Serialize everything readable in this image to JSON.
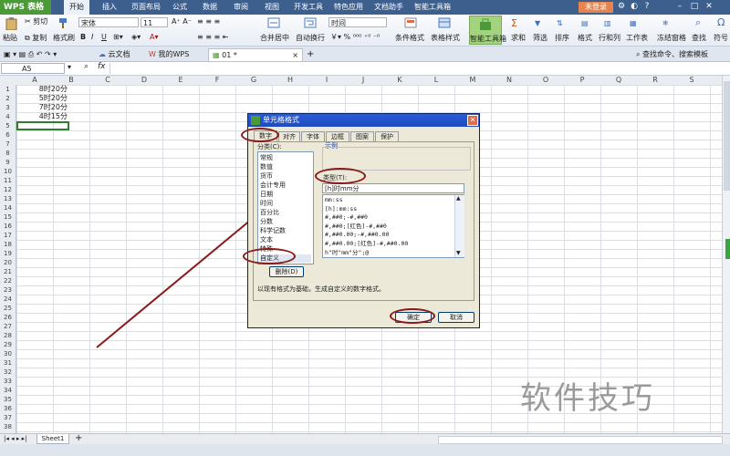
{
  "app": {
    "logo": "WPS 表格"
  },
  "menu": [
    "开始",
    "插入",
    "页面布局",
    "公式",
    "数据",
    "审阅",
    "视图",
    "开发工具",
    "特色应用",
    "文档助手",
    "智能工具箱"
  ],
  "login_label": "未登录",
  "ribbon": {
    "cut": "剪切",
    "paste": "粘贴",
    "copy": "复制",
    "format_painter": "格式刷",
    "font_name": "宋体",
    "font_size": "11",
    "merge_center": "合并居中",
    "wrap": "自动换行",
    "number_format": "时间",
    "cond_format": "条件格式",
    "table_style": "表格样式",
    "smart_toolbox": "智能工具箱",
    "sum": "求和",
    "filter": "筛选",
    "sort": "排序",
    "format": "格式",
    "row_col": "行和列",
    "worksheet": "工作表",
    "freeze": "冻结窗格",
    "find": "查找",
    "symbol": "符号"
  },
  "doc_tabs": [
    "云文档",
    "我的WPS"
  ],
  "current_tab": "01 *",
  "search_hint": "查找命令、搜索模板",
  "name_box": "A5",
  "columns": [
    "A",
    "B",
    "C",
    "D",
    "E",
    "F",
    "G",
    "H",
    "I",
    "J",
    "K",
    "L",
    "M",
    "N",
    "O",
    "P",
    "Q",
    "R",
    "S"
  ],
  "rows": [
    "1",
    "2",
    "3",
    "4",
    "5",
    "6",
    "7",
    "8",
    "9",
    "10",
    "11",
    "12",
    "13",
    "14",
    "15",
    "16",
    "17",
    "18",
    "19",
    "20",
    "21",
    "22",
    "23",
    "24",
    "25",
    "26",
    "27",
    "28",
    "29",
    "30",
    "31",
    "32",
    "33",
    "34",
    "35",
    "36",
    "37",
    "38"
  ],
  "cells": [
    "8时20分",
    "5时20分",
    "7时20分",
    "4时15分"
  ],
  "sheet_tab": "Sheet1",
  "dialog": {
    "title": "单元格格式",
    "tabs": [
      "数字",
      "对齐",
      "字体",
      "边框",
      "图案",
      "保护"
    ],
    "category_label": "分类(C):",
    "categories": [
      "常规",
      "数值",
      "货币",
      "会计专用",
      "日期",
      "时间",
      "百分比",
      "分数",
      "科学记数",
      "文本",
      "特殊",
      "自定义"
    ],
    "sample_label": "示例",
    "type_label": "类型(T):",
    "type_value": "[h]时mm分",
    "type_list": [
      "mm:ss",
      "[h]:mm:ss",
      "#,##0;-#,##0",
      "#,##0;[红色]-#,##0",
      "#,##0.00;-#,##0.00",
      "#,##0.00;[红色]-#,##0.00",
      "h\"时\"mm\"分\";@"
    ],
    "delete_button": "删除(D)",
    "description": "以现有格式为基础，生成自定义的数字格式。",
    "ok": "确定",
    "cancel": "取消"
  },
  "watermark": "软件技巧",
  "colors": {
    "title_bar": "#3d5f8e",
    "accent_green": "#4c9a37",
    "annotation": "#8b1a1a",
    "selection": "#2e7d32"
  }
}
